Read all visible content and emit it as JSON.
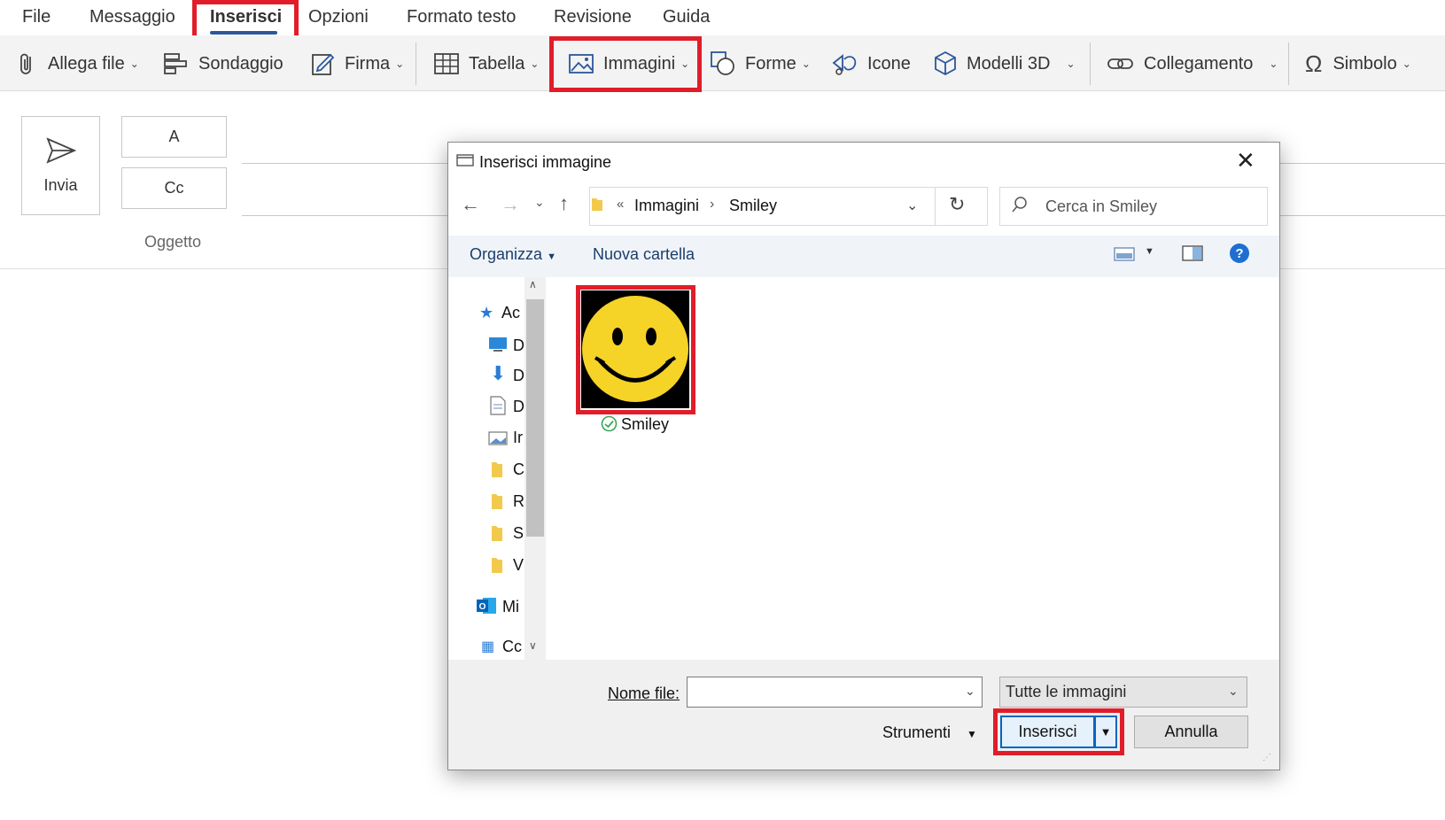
{
  "menu": {
    "tabs": [
      "File",
      "Messaggio",
      "Inserisci",
      "Opzioni",
      "Formato testo",
      "Revisione",
      "Guida"
    ],
    "active_tab": "Inserisci"
  },
  "ribbon": {
    "attach": "Allega file",
    "poll": "Sondaggio",
    "signature": "Firma",
    "table": "Tabella",
    "images": "Immagini",
    "shapes": "Forme",
    "icons": "Icone",
    "models3d": "Modelli 3D",
    "link": "Collegamento",
    "symbol": "Simbolo"
  },
  "compose": {
    "send": "Invia",
    "to": "A",
    "cc": "Cc",
    "subject": "Oggetto"
  },
  "dialog": {
    "title": "Inserisci immagine",
    "breadcrumb": [
      "«",
      "Immagini",
      "Smiley"
    ],
    "search_placeholder": "Cerca in Smiley",
    "organize": "Organizza",
    "new_folder": "Nuova cartella",
    "nav_items": [
      "Ac",
      "D",
      "D",
      "D",
      "Ir",
      "C",
      "R",
      "S",
      "V",
      "Mi",
      "Cc"
    ],
    "file": {
      "name": "Smiley"
    },
    "filename_label": "Nome file:",
    "filename_value": "",
    "filter": "Tutte le immagini",
    "tools": "Strumenti",
    "insert": "Inserisci",
    "cancel": "Annulla"
  },
  "colors": {
    "highlight": "#e11d2a",
    "accent": "#2b579a",
    "smiley": "#f5d327"
  }
}
